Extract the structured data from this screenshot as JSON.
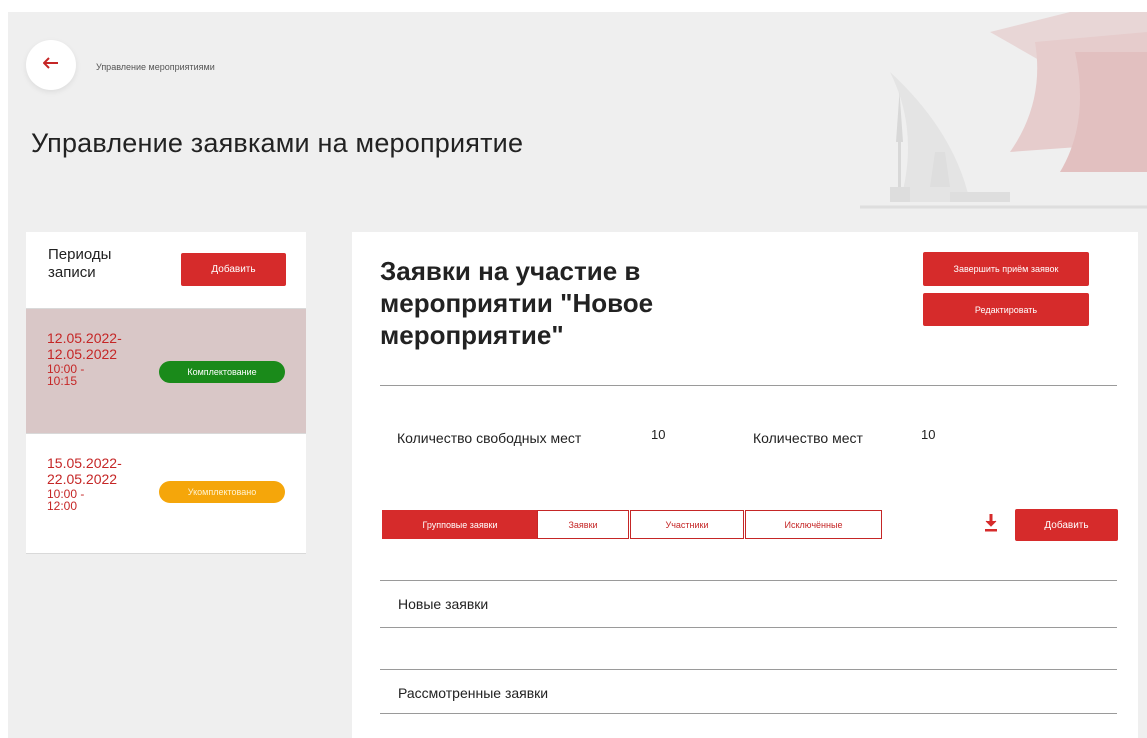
{
  "breadcrumb": "Управление мероприятиями",
  "page_title": "Управление заявками на мероприятие",
  "periods": {
    "title": "Периоды записи",
    "add_label": "Добавить",
    "items": [
      {
        "date_range": "12.05.2022-\n12.05.2022",
        "time_range": "10:00 -\n10:15",
        "status": "Комплектование",
        "status_color": "#1a8a1a",
        "selected": true
      },
      {
        "date_range": "15.05.2022-\n22.05.2022",
        "time_range": "10:00 -\n12:00",
        "status": "Укомплектовано",
        "status_color": "#f5a60a",
        "selected": false
      }
    ]
  },
  "main": {
    "title": "Заявки на участие в мероприятии \"Новое мероприятие\"",
    "finish_label": "Завершить приём заявок",
    "edit_label": "Редактировать",
    "stats": {
      "free_seats_label": "Количество свободных мест",
      "free_seats_value": "10",
      "seats_label": "Количество мест",
      "seats_value": "10"
    },
    "tabs": [
      {
        "label": "Групповые заявки",
        "active": true
      },
      {
        "label": "Заявки",
        "active": false
      },
      {
        "label": "Участники",
        "active": false
      },
      {
        "label": "Исключённые",
        "active": false
      }
    ],
    "download_icon": "download-icon",
    "add_label": "Добавить",
    "sections": {
      "new": "Новые заявки",
      "reviewed": "Рассмотренные заявки"
    }
  },
  "colors": {
    "accent": "#d62b2b",
    "selected_period_bg": "#d9c7c7",
    "page_bg": "#efefef"
  }
}
